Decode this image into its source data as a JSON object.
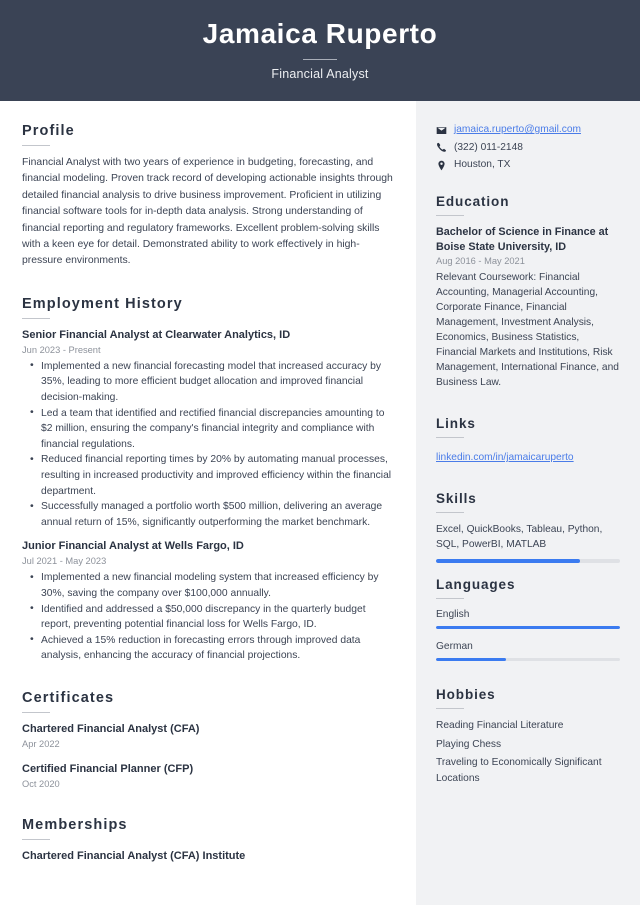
{
  "header": {
    "name": "Jamaica Ruperto",
    "title": "Financial Analyst"
  },
  "main": {
    "profile": {
      "heading": "Profile",
      "text": "Financial Analyst with two years of experience in budgeting, forecasting, and financial modeling. Proven track record of developing actionable insights through detailed financial analysis to drive business improvement. Proficient in utilizing financial software tools for in-depth data analysis. Strong understanding of financial reporting and regulatory frameworks. Excellent problem-solving skills with a keen eye for detail. Demonstrated ability to work effectively in high-pressure environments."
    },
    "employment": {
      "heading": "Employment History",
      "jobs": [
        {
          "title": "Senior Financial Analyst at Clearwater Analytics, ID",
          "date": "Jun 2023 - Present",
          "bullets": [
            "Implemented a new financial forecasting model that increased accuracy by 35%, leading to more efficient budget allocation and improved financial decision-making.",
            "Led a team that identified and rectified financial discrepancies amounting to $2 million, ensuring the company's financial integrity and compliance with financial regulations.",
            "Reduced financial reporting times by 20% by automating manual processes, resulting in increased productivity and improved efficiency within the financial department.",
            "Successfully managed a portfolio worth $500 million, delivering an average annual return of 15%, significantly outperforming the market benchmark."
          ]
        },
        {
          "title": "Junior Financial Analyst at Wells Fargo, ID",
          "date": "Jul 2021 - May 2023",
          "bullets": [
            "Implemented a new financial modeling system that increased efficiency by 30%, saving the company over $100,000 annually.",
            "Identified and addressed a $50,000 discrepancy in the quarterly budget report, preventing potential financial loss for Wells Fargo, ID.",
            "Achieved a 15% reduction in forecasting errors through improved data analysis, enhancing the accuracy of financial projections."
          ]
        }
      ]
    },
    "certificates": {
      "heading": "Certificates",
      "items": [
        {
          "title": "Chartered Financial Analyst (CFA)",
          "date": "Apr 2022"
        },
        {
          "title": "Certified Financial Planner (CFP)",
          "date": "Oct 2020"
        }
      ]
    },
    "memberships": {
      "heading": "Memberships",
      "items": [
        {
          "title": "Chartered Financial Analyst (CFA) Institute"
        }
      ]
    }
  },
  "sidebar": {
    "contact": [
      {
        "icon": "envelope-icon",
        "text": "jamaica.ruperto@gmail.com",
        "is_link": true
      },
      {
        "icon": "phone-icon",
        "text": "(322) 011-2148",
        "is_link": false
      },
      {
        "icon": "location-pin-icon",
        "text": "Houston, TX",
        "is_link": false
      }
    ],
    "education": {
      "heading": "Education",
      "degree": "Bachelor of Science in Finance at Boise State University, ID",
      "date": "Aug 2016 - May 2021",
      "description": "Relevant Coursework: Financial Accounting, Managerial Accounting, Corporate Finance, Financial Management, Investment Analysis, Economics, Business Statistics, Financial Markets and Institutions, Risk Management, International Finance, and Business Law."
    },
    "links": {
      "heading": "Links",
      "items": [
        {
          "label": "linkedin.com/in/jamaicaruperto"
        }
      ]
    },
    "skills": {
      "heading": "Skills",
      "text": "Excel, QuickBooks, Tableau, Python, SQL, PowerBI, MATLAB",
      "level_percent": 78
    },
    "languages": {
      "heading": "Languages",
      "items": [
        {
          "name": "English",
          "level_percent": 100
        },
        {
          "name": "German",
          "level_percent": 38
        }
      ]
    },
    "hobbies": {
      "heading": "Hobbies",
      "items": [
        "Reading Financial Literature",
        "Playing Chess",
        "Traveling to Economically Significant Locations"
      ]
    }
  },
  "theme": {
    "header_bg": "#3a4355",
    "sidebar_bg": "#f1f2f4",
    "accent_blue": "#3b7bf0",
    "link_blue": "#4a7ce8",
    "text_dark": "#2b3342",
    "text_muted": "#8d929b"
  }
}
